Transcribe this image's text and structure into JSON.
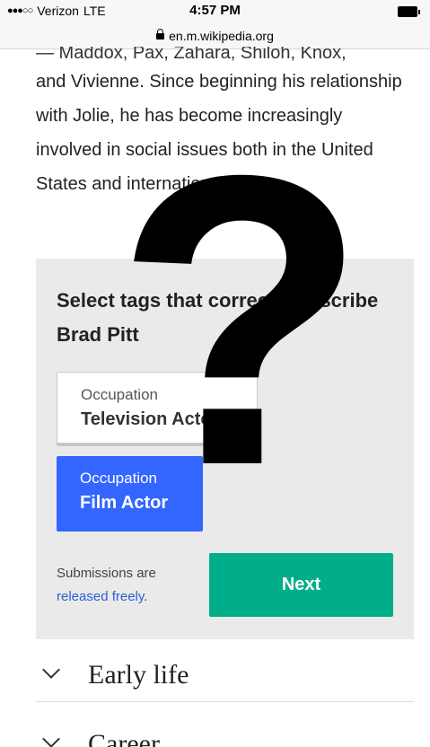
{
  "status_bar": {
    "signal": "●●●○○",
    "carrier": "Verizon",
    "network": "LTE",
    "time": "4:57 PM"
  },
  "url_bar": {
    "url": "en.m.wikipedia.org"
  },
  "article": {
    "cut_line": "— Maddox, Pax, Zahara, Shiloh, Knox,",
    "paragraph": "and Vivienne. Since beginning his relationship with Jolie, he has become increasingly involved in social issues both in the United States and internationally."
  },
  "tag_panel": {
    "title": "Select tags that correctly describe Brad Pitt",
    "tags": [
      {
        "type": "Occupation",
        "value": "Television Actor"
      },
      {
        "type": "Occupation",
        "value": "Film Actor"
      }
    ],
    "submissions_text": "Submissions are",
    "submissions_link": "released freely",
    "submissions_end": ".",
    "next_label": "Next",
    "selected_color": "#3366ff",
    "next_color": "#00af89"
  },
  "sections": [
    {
      "title": "Early life"
    },
    {
      "title": "Career"
    }
  ],
  "overlay": {
    "symbol": "?"
  }
}
